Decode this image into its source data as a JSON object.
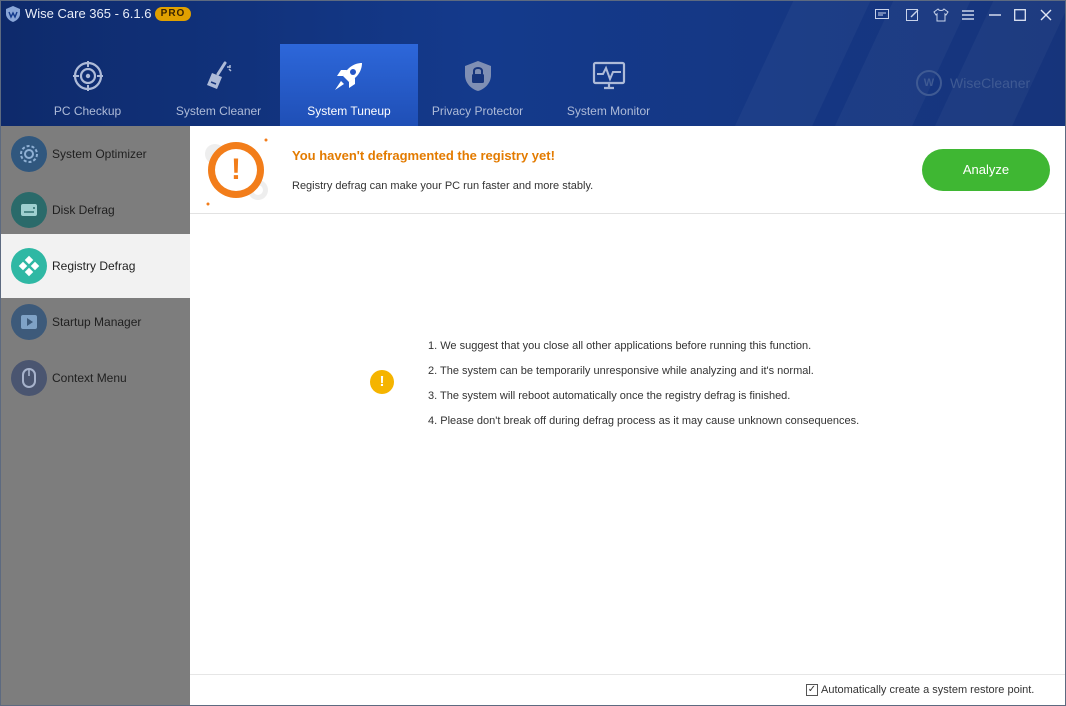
{
  "app": {
    "title": "Wise Care 365 - 6.1.6",
    "badge": "PRO",
    "brand": "WiseCleaner",
    "brand_mark": "W"
  },
  "titlebar_icons": [
    "feedback-icon",
    "edit-icon",
    "skin-shirt-icon",
    "menu-icon",
    "minimize-icon",
    "maximize-icon",
    "close-icon"
  ],
  "tabs": [
    {
      "label": "PC Checkup",
      "icon": "target-icon",
      "active": false
    },
    {
      "label": "System Cleaner",
      "icon": "broom-icon",
      "active": false
    },
    {
      "label": "System Tuneup",
      "icon": "rocket-icon",
      "active": true
    },
    {
      "label": "Privacy Protector",
      "icon": "lock-shield-icon",
      "active": false
    },
    {
      "label": "System Monitor",
      "icon": "monitor-pulse-icon",
      "active": false
    }
  ],
  "sidebar": {
    "items": [
      {
        "label": "System Optimizer",
        "icon": "gear-icon",
        "active": false
      },
      {
        "label": "Disk Defrag",
        "icon": "disk-icon",
        "active": false
      },
      {
        "label": "Registry Defrag",
        "icon": "registry-blocks-icon",
        "active": true
      },
      {
        "label": "Startup Manager",
        "icon": "play-icon",
        "active": false
      },
      {
        "label": "Context Menu",
        "icon": "mouse-icon",
        "active": false
      }
    ]
  },
  "banner": {
    "title": "You haven't defragmented the registry yet!",
    "subtitle": "Registry defrag can make your PC run faster and more stably.",
    "button": "Analyze",
    "status_mark": "!"
  },
  "tips": {
    "mark": "!",
    "items": [
      "1. We suggest that you close all other applications before running this function.",
      "2. The system can be temporarily unresponsive while analyzing and it's normal.",
      "3. The system will reboot automatically once the registry defrag is finished.",
      "4. Please don't break off during defrag process as it may cause unknown consequences."
    ]
  },
  "footer": {
    "restore_label": "Automatically create a system restore point.",
    "restore_checked": true,
    "check_mark": "✓"
  },
  "colors": {
    "header": "#143a8c",
    "active_tab": "#2557c8",
    "warning": "#e37b00",
    "analyze": "#3fb733",
    "sidebar": "#7d7d7d"
  }
}
